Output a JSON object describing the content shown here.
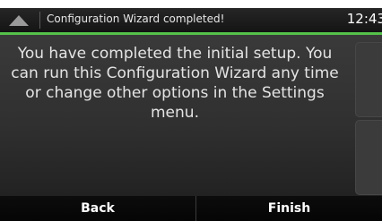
{
  "status_bar": {
    "icon": "chevron-up-icon",
    "message": "Configuration Wizard completed!",
    "clock": "12:43"
  },
  "main": {
    "message": "You have completed the initial setup. You can run this Configuration Wizard any time or change other options in the Settings menu."
  },
  "buttons": {
    "back_label": "Back",
    "finish_label": "Finish"
  },
  "colors": {
    "accent": "#55c24a",
    "background": "#303030"
  }
}
